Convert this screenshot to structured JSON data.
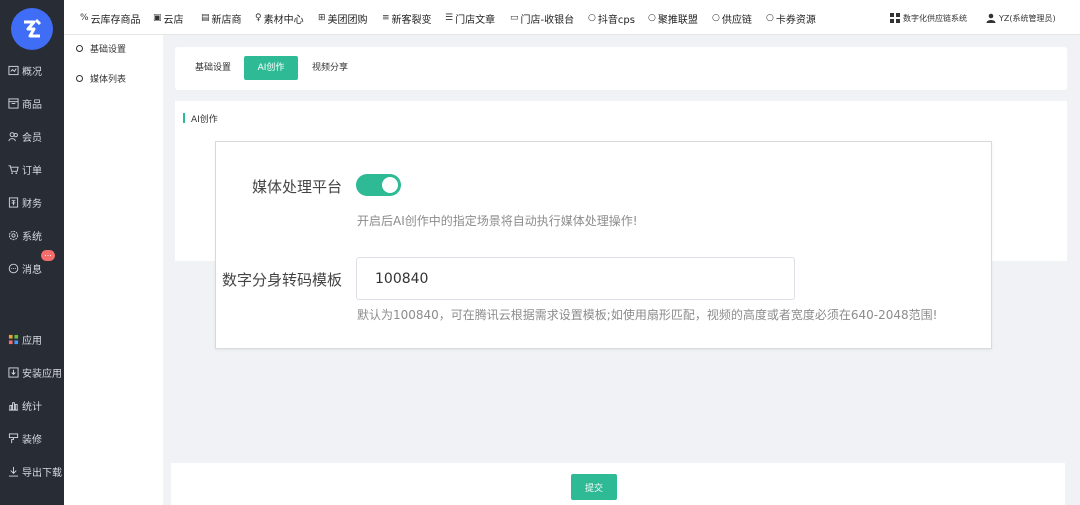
{
  "sidebar": {
    "items": [
      {
        "label": "概况",
        "icon": "dashboard-icon"
      },
      {
        "label": "商品",
        "icon": "goods-icon"
      },
      {
        "label": "会员",
        "icon": "members-icon"
      },
      {
        "label": "订单",
        "icon": "cart-icon"
      },
      {
        "label": "财务",
        "icon": "finance-icon"
      },
      {
        "label": "系统",
        "icon": "gear-icon"
      },
      {
        "label": "消息",
        "icon": "message-icon"
      },
      {
        "label": "应用",
        "icon": "apps-icon"
      },
      {
        "label": "安装应用",
        "icon": "install-icon"
      },
      {
        "label": "统计",
        "icon": "stats-icon"
      },
      {
        "label": "装修",
        "icon": "decorate-icon"
      },
      {
        "label": "导出下载",
        "icon": "download-icon"
      }
    ],
    "message_badge": "..."
  },
  "topnav": {
    "items": [
      {
        "label": "云库存商品",
        "icon": "%"
      },
      {
        "label": "云店",
        "icon": "▣"
      },
      {
        "label": "新店商",
        "icon": "▤"
      },
      {
        "label": "素材中心",
        "icon": "♀"
      },
      {
        "label": "美团团购",
        "icon": "⊞"
      },
      {
        "label": "新客裂变",
        "icon": "≡"
      },
      {
        "label": "门店文章",
        "icon": "☰"
      },
      {
        "label": "门店-收银台",
        "icon": "▭"
      },
      {
        "label": "抖音cps",
        "icon": "○"
      },
      {
        "label": "聚推联盟",
        "icon": "○"
      },
      {
        "label": "供应链",
        "icon": "○"
      },
      {
        "label": "卡券资源",
        "icon": "○"
      }
    ],
    "system_label": "数字化供应链系统",
    "user_label": "YZ(系统管理员)"
  },
  "submenu": {
    "items": [
      "基础设置",
      "媒体列表"
    ]
  },
  "tabs": [
    "基础设置",
    "AI创作",
    "视频分享"
  ],
  "section": {
    "title": "AI创作"
  },
  "form": {
    "media_platform_label": "媒体处理平台",
    "media_platform_enabled": true,
    "media_platform_hint": "开启后AI创作中的指定场景将自动执行媒体处理操作!",
    "template_label": "数字分身转码模板",
    "template_value": "100840",
    "template_hint": "默认为100840，可在腾讯云根据需求设置模板;如使用扇形匹配，视频的高度或者宽度必须在640-2048范围!"
  },
  "footer": {
    "submit_label": "提交"
  },
  "colors": {
    "accent": "#2fba96",
    "sidebar_bg": "#282c34",
    "logo": "#3f6df5",
    "badge": "#f56c6c"
  }
}
